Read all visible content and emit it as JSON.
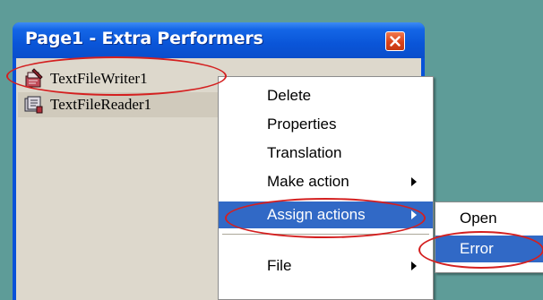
{
  "window": {
    "title": "Page1 - Extra Performers",
    "close_icon": "close-icon"
  },
  "list": {
    "items": [
      {
        "label": "TextFileWriter1",
        "icon": "text-file-writer-icon",
        "state": "selected"
      },
      {
        "label": "TextFileReader1",
        "icon": "text-file-reader-icon",
        "state": "normal"
      }
    ]
  },
  "context_menu": {
    "items": [
      {
        "label": "Delete",
        "has_submenu": false
      },
      {
        "label": "Properties",
        "has_submenu": false
      },
      {
        "label": "Translation",
        "has_submenu": false
      },
      {
        "label": "Make action",
        "has_submenu": true
      },
      {
        "label": "Assign actions",
        "has_submenu": true,
        "highlighted": true
      },
      {
        "label": "File",
        "has_submenu": true
      }
    ]
  },
  "submenu": {
    "items": [
      {
        "label": "Open",
        "highlighted": false
      },
      {
        "label": "Error",
        "highlighted": true
      }
    ]
  },
  "colors": {
    "desktop": "#5e9c98",
    "titlebar": "#0a55d8",
    "menu_highlight": "#3169c6",
    "annotation": "#d42020",
    "client_bg": "#ddd8cc"
  }
}
